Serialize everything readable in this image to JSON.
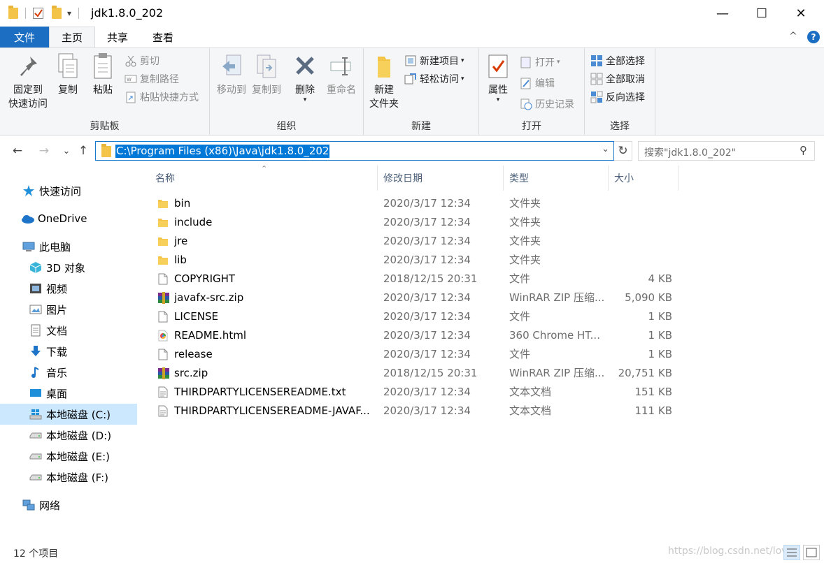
{
  "window": {
    "title": "jdk1.8.0_202",
    "minimize": "—",
    "maximize": "☐",
    "close": "✕"
  },
  "quick_access": {
    "dropdown": "▾"
  },
  "tabs": [
    {
      "label": "文件"
    },
    {
      "label": "主页"
    },
    {
      "label": "共享"
    },
    {
      "label": "查看"
    }
  ],
  "ribbon_controls": {
    "collapse": "^",
    "help": "?"
  },
  "ribbon": {
    "clipboard": {
      "group_label": "剪贴板",
      "pin_line1": "固定到",
      "pin_line2": "快速访问",
      "copy": "复制",
      "paste": "粘贴",
      "cut": "剪切",
      "copy_path": "复制路径",
      "paste_shortcut": "粘贴快捷方式"
    },
    "organize": {
      "group_label": "组织",
      "move_to": "移动到",
      "copy_to": "复制到",
      "delete": "删除",
      "rename": "重命名"
    },
    "new": {
      "group_label": "新建",
      "new_folder_line1": "新建",
      "new_folder_line2": "文件夹",
      "new_item": "新建项目",
      "easy_access": "轻松访问"
    },
    "open": {
      "group_label": "打开",
      "properties": "属性",
      "open": "打开",
      "edit": "编辑",
      "history": "历史记录"
    },
    "select": {
      "group_label": "选择",
      "select_all": "全部选择",
      "select_none": "全部取消",
      "invert": "反向选择"
    }
  },
  "address": {
    "path": "C:\\Program Files (x86)\\Java\\jdk1.8.0_202",
    "search_placeholder": "搜索\"jdk1.8.0_202\"",
    "back": "←",
    "forward": "→",
    "recent": "⌄",
    "up": "↑",
    "refresh": "↻",
    "dropdown": "⌄",
    "search_icon": "⚲"
  },
  "nav": [
    {
      "label": "快速访问",
      "icon": "star-icon"
    },
    {
      "label": "OneDrive",
      "icon": "cloud-icon"
    },
    {
      "label": "此电脑",
      "icon": "computer-icon"
    },
    {
      "label": "3D 对象",
      "icon": "cube-icon"
    },
    {
      "label": "视频",
      "icon": "video-icon"
    },
    {
      "label": "图片",
      "icon": "picture-icon"
    },
    {
      "label": "文档",
      "icon": "document-icon"
    },
    {
      "label": "下载",
      "icon": "download-icon"
    },
    {
      "label": "音乐",
      "icon": "music-icon"
    },
    {
      "label": "桌面",
      "icon": "desktop-icon"
    },
    {
      "label": "本地磁盘 (C:)",
      "icon": "windows-drive-icon"
    },
    {
      "label": "本地磁盘 (D:)",
      "icon": "drive-icon"
    },
    {
      "label": "本地磁盘 (E:)",
      "icon": "drive-icon"
    },
    {
      "label": "本地磁盘 (F:)",
      "icon": "drive-icon"
    },
    {
      "label": "网络",
      "icon": "network-icon"
    }
  ],
  "columns": {
    "name": "名称",
    "date": "修改日期",
    "type": "类型",
    "size": "大小"
  },
  "files": [
    {
      "name": "bin",
      "date": "2020/3/17 12:34",
      "type": "文件夹",
      "size": "",
      "icon": "folder-icon"
    },
    {
      "name": "include",
      "date": "2020/3/17 12:34",
      "type": "文件夹",
      "size": "",
      "icon": "folder-icon"
    },
    {
      "name": "jre",
      "date": "2020/3/17 12:34",
      "type": "文件夹",
      "size": "",
      "icon": "folder-icon"
    },
    {
      "name": "lib",
      "date": "2020/3/17 12:34",
      "type": "文件夹",
      "size": "",
      "icon": "folder-icon"
    },
    {
      "name": "COPYRIGHT",
      "date": "2018/12/15 20:31",
      "type": "文件",
      "size": "4 KB",
      "icon": "file-icon"
    },
    {
      "name": "javafx-src.zip",
      "date": "2020/3/17 12:34",
      "type": "WinRAR ZIP 压缩...",
      "size": "5,090 KB",
      "icon": "winrar-icon"
    },
    {
      "name": "LICENSE",
      "date": "2020/3/17 12:34",
      "type": "文件",
      "size": "1 KB",
      "icon": "file-icon"
    },
    {
      "name": "README.html",
      "date": "2020/3/17 12:34",
      "type": "360 Chrome HT...",
      "size": "1 KB",
      "icon": "browser-icon"
    },
    {
      "name": "release",
      "date": "2020/3/17 12:34",
      "type": "文件",
      "size": "1 KB",
      "icon": "file-icon"
    },
    {
      "name": "src.zip",
      "date": "2018/12/15 20:31",
      "type": "WinRAR ZIP 压缩...",
      "size": "20,751 KB",
      "icon": "winrar-icon"
    },
    {
      "name": "THIRDPARTYLICENSEREADME.txt",
      "date": "2020/3/17 12:34",
      "type": "文本文档",
      "size": "151 KB",
      "icon": "text-file-icon"
    },
    {
      "name": "THIRDPARTYLICENSEREADME-JAVAF...",
      "date": "2020/3/17 12:34",
      "type": "文本文档",
      "size": "111 KB",
      "icon": "text-file-icon"
    }
  ],
  "status": {
    "count": "12 个项目",
    "watermark": "https://blog.csdn.net/lov..."
  },
  "colors": {
    "accent": "#1b6ec2",
    "selection": "#cce8ff",
    "address_highlight": "#0078d7",
    "folder": "#f3c447"
  }
}
